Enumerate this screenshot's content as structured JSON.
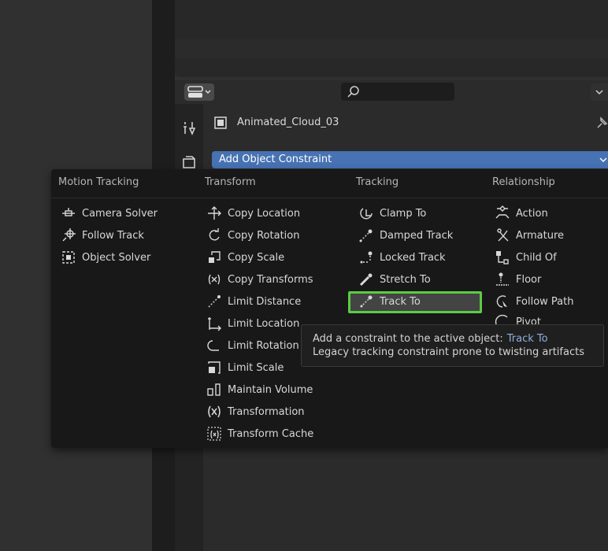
{
  "properties": {
    "object_name": "Animated_Cloud_03",
    "add_constraint_label": "Add Object Constraint",
    "search_placeholder": ""
  },
  "menu": {
    "columns": [
      {
        "heading": "Motion Tracking",
        "items": [
          {
            "label": "Camera Solver",
            "icon": "camera-solver-icon"
          },
          {
            "label": "Follow Track",
            "icon": "follow-track-icon"
          },
          {
            "label": "Object Solver",
            "icon": "object-solver-icon"
          }
        ]
      },
      {
        "heading": "Transform",
        "items": [
          {
            "label": "Copy Location",
            "icon": "copy-location-icon"
          },
          {
            "label": "Copy Rotation",
            "icon": "copy-rotation-icon"
          },
          {
            "label": "Copy Scale",
            "icon": "copy-scale-icon"
          },
          {
            "label": "Copy Transforms",
            "icon": "copy-transforms-icon"
          },
          {
            "label": "Limit Distance",
            "icon": "limit-distance-icon"
          },
          {
            "label": "Limit Location",
            "icon": "limit-location-icon"
          },
          {
            "label": "Limit Rotation",
            "icon": "limit-rotation-icon"
          },
          {
            "label": "Limit Scale",
            "icon": "limit-scale-icon"
          },
          {
            "label": "Maintain Volume",
            "icon": "maintain-volume-icon"
          },
          {
            "label": "Transformation",
            "icon": "transformation-icon"
          },
          {
            "label": "Transform Cache",
            "icon": "transform-cache-icon"
          }
        ]
      },
      {
        "heading": "Tracking",
        "items": [
          {
            "label": "Clamp To",
            "icon": "clamp-to-icon"
          },
          {
            "label": "Damped Track",
            "icon": "damped-track-icon"
          },
          {
            "label": "Locked Track",
            "icon": "locked-track-icon"
          },
          {
            "label": "Stretch To",
            "icon": "stretch-to-icon"
          },
          {
            "label": "Track To",
            "icon": "track-to-icon",
            "highlighted": true
          }
        ]
      },
      {
        "heading": "Relationship",
        "items": [
          {
            "label": "Action",
            "icon": "action-icon"
          },
          {
            "label": "Armature",
            "icon": "armature-icon"
          },
          {
            "label": "Child Of",
            "icon": "child-of-icon"
          },
          {
            "label": "Floor",
            "icon": "floor-icon"
          },
          {
            "label": "Follow Path",
            "icon": "follow-path-icon"
          },
          {
            "label": "Pivot",
            "icon": "pivot-icon"
          }
        ]
      }
    ]
  },
  "tooltip": {
    "line1": "Add a constraint to the active object:",
    "line1_highlight": "Track To",
    "line2": "Legacy tracking constraint prone to twisting artifacts"
  },
  "colors": {
    "accent_blue": "#4772b3",
    "highlight_green": "#5dcb45",
    "tooltip_highlight": "#8fb0de"
  }
}
